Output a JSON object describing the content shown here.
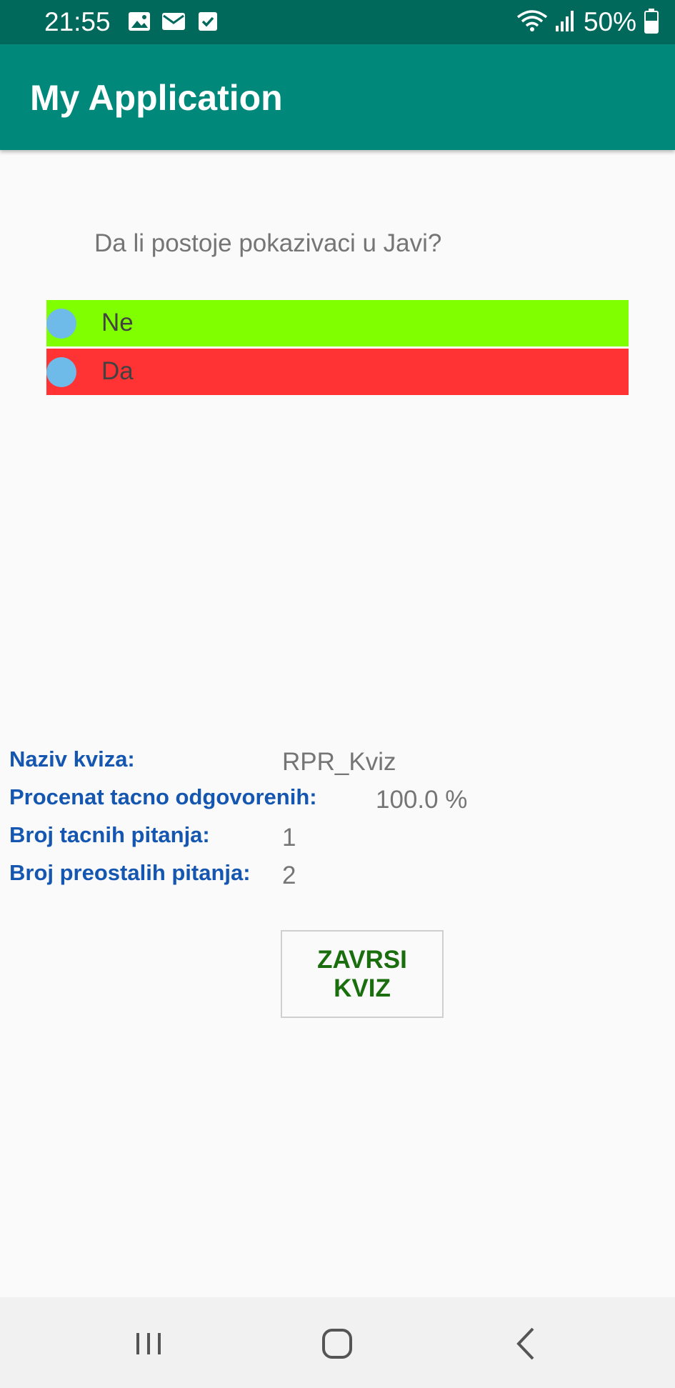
{
  "status_bar": {
    "time": "21:55",
    "battery": "50%",
    "icons": [
      "image-icon",
      "mail-icon",
      "check-icon",
      "wifi-icon",
      "signal-icon",
      "battery-icon"
    ]
  },
  "app_bar": {
    "title": "My Application"
  },
  "quiz": {
    "question": "Da li postoje pokazivaci u Javi?",
    "answers": [
      {
        "label": "Ne",
        "color": "#80ff00"
      },
      {
        "label": "Da",
        "color": "#ff3333"
      }
    ]
  },
  "info": {
    "quiz_name_label": "Naziv kviza:",
    "quiz_name_value": "RPR_Kviz",
    "percent_label": "Procenat tacno odgovorenih:",
    "percent_value": "100.0 %",
    "correct_label": "Broj tacnih pitanja:",
    "correct_value": "1",
    "remaining_label": "Broj preostalih pitanja:",
    "remaining_value": "2"
  },
  "finish_button": {
    "label": "ZAVRSI KVIZ"
  },
  "nav_bar": {
    "icons": [
      "recent-apps-icon",
      "home-icon",
      "back-icon"
    ]
  }
}
